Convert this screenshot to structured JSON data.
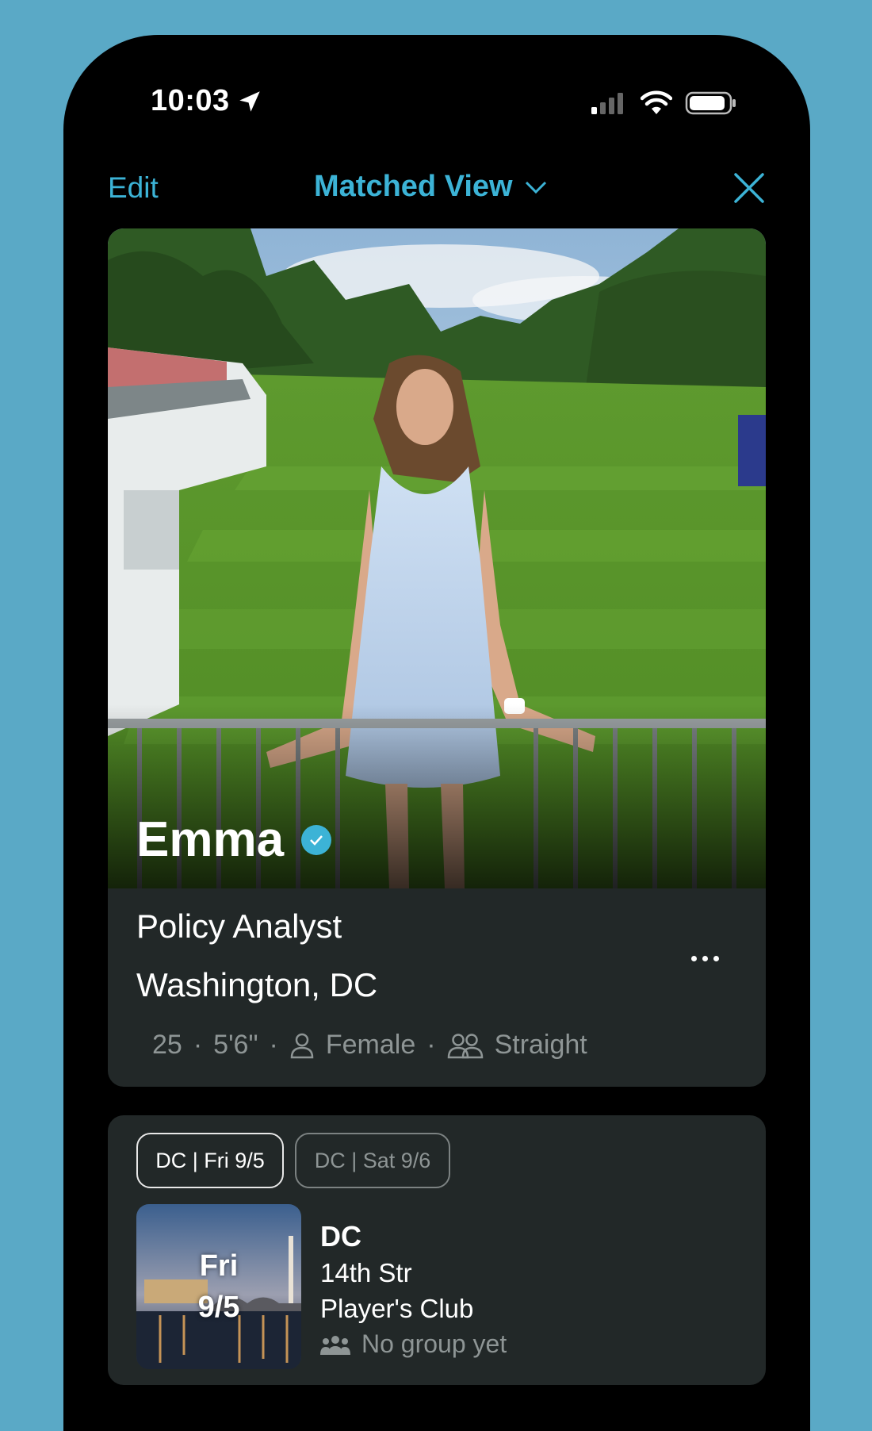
{
  "status": {
    "time": "10:03"
  },
  "nav": {
    "edit_label": "Edit",
    "title": "Matched View"
  },
  "profile": {
    "name": "Emma",
    "job": "Policy Analyst",
    "location": "Washington, DC",
    "age": "25",
    "height": "5'6\"",
    "gender": "Female",
    "orientation": "Straight"
  },
  "event": {
    "chips": [
      "DC | Fri 9/5",
      "DC | Sat 9/6"
    ],
    "date_day": "Fri",
    "date_num": "9/5",
    "city": "DC",
    "venue_line1": "14th Str",
    "venue_line2": "Player's Club",
    "group_status": "No group yet"
  },
  "colors": {
    "accent": "#3cb3d6",
    "background": "#5aa9c6",
    "card": "#222828"
  }
}
